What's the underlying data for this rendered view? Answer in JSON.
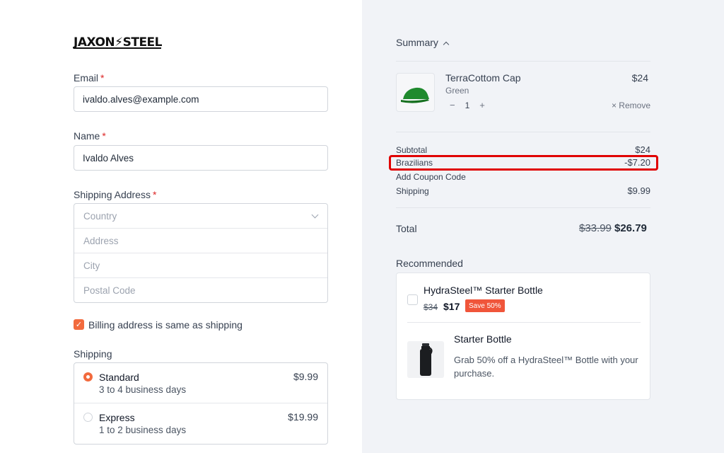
{
  "brand": {
    "logo_text": "JAXON⚡STEEL"
  },
  "form": {
    "email": {
      "label": "Email",
      "required_mark": "*",
      "value": "ivaldo.alves@example.com"
    },
    "name": {
      "label": "Name",
      "required_mark": "*",
      "value": "Ivaldo Alves"
    },
    "shipping_address": {
      "label": "Shipping Address",
      "required_mark": "*",
      "country_placeholder": "Country",
      "address_placeholder": "Address",
      "city_placeholder": "City",
      "postal_placeholder": "Postal Code"
    },
    "billing_same": {
      "label": "Billing address is same as shipping",
      "checked": true
    },
    "shipping": {
      "label": "Shipping",
      "options": [
        {
          "name": "Standard",
          "subtitle": "3 to 4 business days",
          "price": "$9.99",
          "selected": true
        },
        {
          "name": "Express",
          "subtitle": "1 to 2 business days",
          "price": "$19.99",
          "selected": false
        }
      ]
    }
  },
  "summary": {
    "title": "Summary",
    "item": {
      "name": "TerraCottom Cap",
      "variant": "Green",
      "price": "$24",
      "qty": "1",
      "minus": "−",
      "plus": "+",
      "remove": "× Remove"
    },
    "rows": {
      "subtotal_label": "Subtotal",
      "subtotal_value": "$24",
      "discount_label": "Brazilians",
      "discount_value": "-$7.20",
      "coupon_label": "Add Coupon Code",
      "shipping_label": "Shipping",
      "shipping_value": "$9.99"
    },
    "total": {
      "label": "Total",
      "old": "$33.99",
      "new": "$26.79"
    }
  },
  "recommended": {
    "title": "Recommended",
    "product": {
      "name": "HydraSteel™ Starter Bottle",
      "old_price": "$34",
      "price": "$17",
      "badge": "Save 50%"
    },
    "promo": {
      "title": "Starter Bottle",
      "description": "Grab 50% off a HydraSteel™ Bottle with your purchase."
    }
  },
  "colors": {
    "accent": "#f26a3d",
    "highlight": "#e00000",
    "panel": "#f1f3f7"
  }
}
